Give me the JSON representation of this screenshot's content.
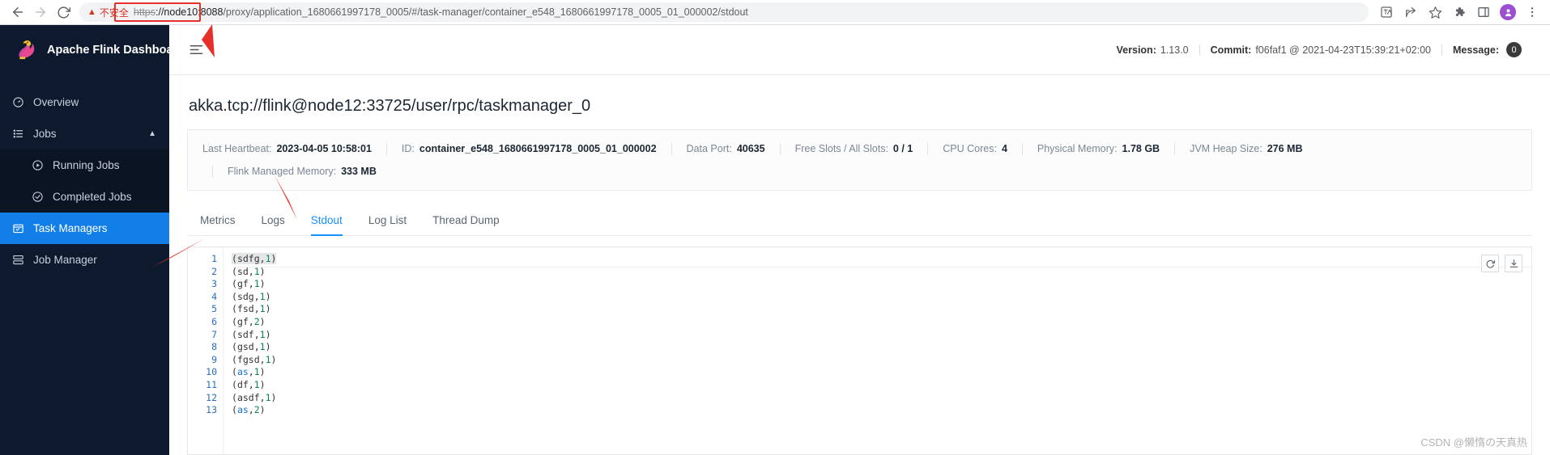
{
  "browser": {
    "back_icon": "arrow-left-icon",
    "forward_icon": "arrow-right-icon",
    "reload_icon": "reload-icon",
    "security_warning": "不安全",
    "url_scheme": "https",
    "url_host": "://node10:8088",
    "url_rest": "/proxy/application_1680661997178_0005/#/task-manager/container_e548_1680661997178_0005_01_000002/stdout",
    "toolbar_icons": [
      "translate-icon",
      "share-icon",
      "bookmark-star-icon",
      "extensions-puzzle-icon",
      "side-panel-icon",
      "profile-avatar",
      "chrome-menu-icon"
    ],
    "annotation_color": "#e8302a"
  },
  "sidebar": {
    "brand": "Apache Flink Dashboard",
    "items": [
      {
        "label": "Overview",
        "icon": "dashboard-icon",
        "active": false
      },
      {
        "label": "Jobs",
        "icon": "list-icon",
        "active": false,
        "expanded": true
      },
      {
        "label": "Running Jobs",
        "icon": "play-circle-icon",
        "active": false,
        "sub": true
      },
      {
        "label": "Completed Jobs",
        "icon": "check-circle-icon",
        "active": false,
        "sub": true
      },
      {
        "label": "Task Managers",
        "icon": "task-manager-icon",
        "active": true
      },
      {
        "label": "Job Manager",
        "icon": "job-manager-icon",
        "active": false
      }
    ]
  },
  "topbar": {
    "menu_toggle_icon": "hamburger-menu-icon",
    "version_label": "Version:",
    "version_value": "1.13.0",
    "commit_label": "Commit:",
    "commit_value": "f06faf1 @ 2021-04-23T15:39:21+02:00",
    "message_label": "Message:",
    "message_count": "0"
  },
  "page": {
    "title": "akka.tcp://flink@node12:33725/user/rpc/taskmanager_0",
    "info_row_1": [
      {
        "key": "Last Heartbeat:",
        "value": "2023-04-05 10:58:01"
      },
      {
        "key": "ID:",
        "value": "container_e548_1680661997178_0005_01_000002"
      },
      {
        "key": "Data Port:",
        "value": "40635"
      },
      {
        "key": "Free Slots / All Slots:",
        "value": "0 / 1"
      },
      {
        "key": "CPU Cores:",
        "value": "4"
      },
      {
        "key": "Physical Memory:",
        "value": "1.78 GB"
      },
      {
        "key": "JVM Heap Size:",
        "value": "276 MB"
      }
    ],
    "info_row_2": [
      {
        "key": "Flink Managed Memory:",
        "value": "333 MB"
      }
    ],
    "tabs": [
      {
        "label": "Metrics",
        "active": false
      },
      {
        "label": "Logs",
        "active": false
      },
      {
        "label": "Stdout",
        "active": true
      },
      {
        "label": "Log List",
        "active": false
      },
      {
        "label": "Thread Dump",
        "active": false
      }
    ],
    "editor_actions": [
      {
        "name": "refresh-button",
        "icon": "refresh-icon"
      },
      {
        "name": "download-button",
        "icon": "download-icon"
      }
    ],
    "stdout_lines": [
      {
        "n": "1",
        "word": "sdfg",
        "count": "1",
        "kw": false
      },
      {
        "n": "2",
        "word": "sd",
        "count": "1",
        "kw": false
      },
      {
        "n": "3",
        "word": "gf",
        "count": "1",
        "kw": false
      },
      {
        "n": "4",
        "word": "sdg",
        "count": "1",
        "kw": false
      },
      {
        "n": "5",
        "word": "fsd",
        "count": "1",
        "kw": false
      },
      {
        "n": "6",
        "word": "gf",
        "count": "2",
        "kw": false
      },
      {
        "n": "7",
        "word": "sdf",
        "count": "1",
        "kw": false
      },
      {
        "n": "8",
        "word": "gsd",
        "count": "1",
        "kw": false
      },
      {
        "n": "9",
        "word": "fgsd",
        "count": "1",
        "kw": false
      },
      {
        "n": "10",
        "word": "as",
        "count": "1",
        "kw": true
      },
      {
        "n": "11",
        "word": "df",
        "count": "1",
        "kw": false
      },
      {
        "n": "12",
        "word": "asdf",
        "count": "1",
        "kw": false
      },
      {
        "n": "13",
        "word": "as",
        "count": "2",
        "kw": true
      }
    ],
    "watermark": "CSDN @懒惰の天真热"
  }
}
